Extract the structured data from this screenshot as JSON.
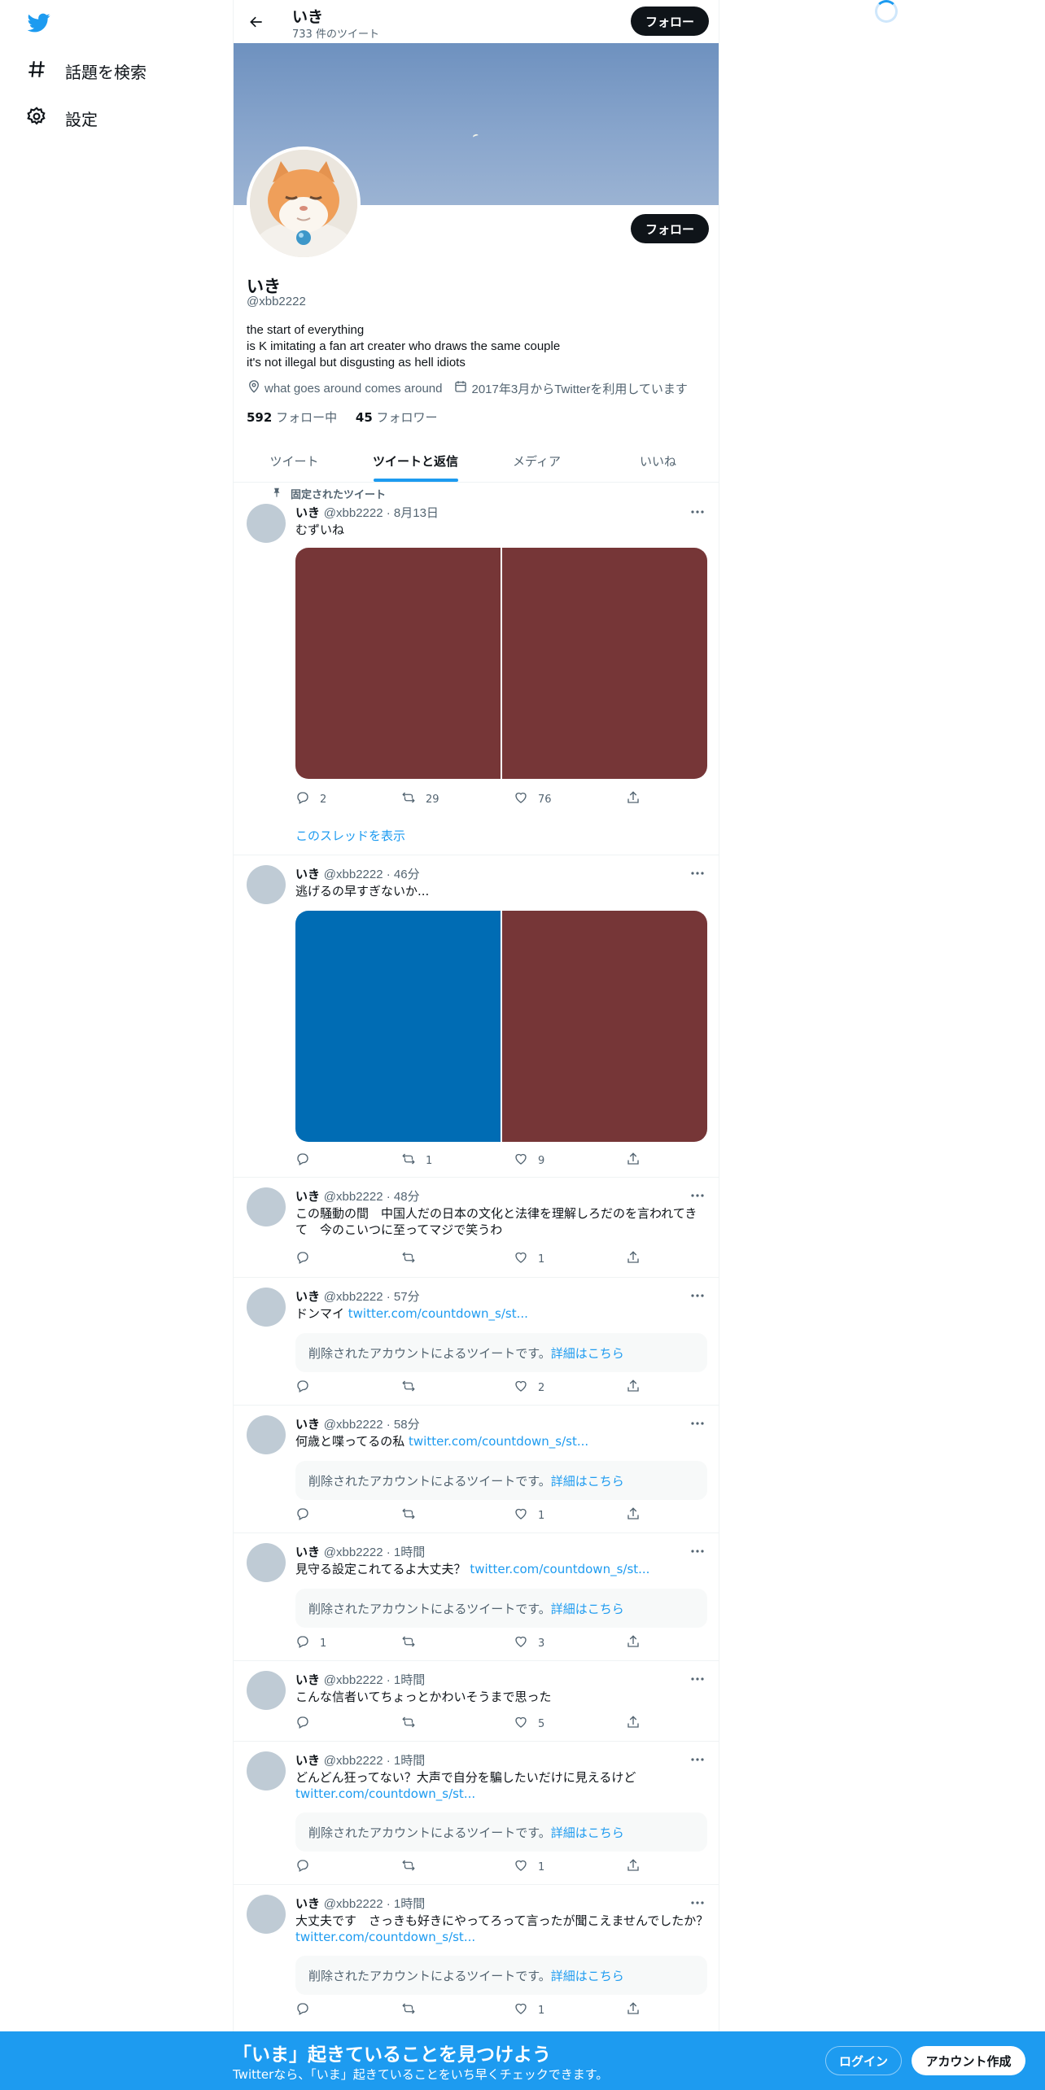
{
  "sidebar": {
    "logo_icon": "twitter-bird-icon",
    "items": [
      {
        "icon": "hashtag-icon",
        "label": "話題を検索"
      },
      {
        "icon": "gear-icon",
        "label": "設定"
      }
    ]
  },
  "header": {
    "name": "いき",
    "tweet_count": "733 件のツイート",
    "follow_label": "フォロー"
  },
  "profile": {
    "name": "いき",
    "handle": "@xbb2222",
    "bio_lines": [
      "the start of everything",
      "is K imitating a fan art creater who draws the same couple",
      "it's not illegal but disgusting as hell idiots"
    ],
    "location": "what goes around comes around",
    "joined": "2017年3月からTwitterを利用しています",
    "following_count": "592",
    "following_label": "フォロー中",
    "followers_count": "45",
    "followers_label": "フォロワー",
    "follow_label": "フォロー"
  },
  "tabs": [
    "ツイート",
    "ツイートと返信",
    "メディア",
    "いいね"
  ],
  "pinned_label": "固定されたツイート",
  "thread_link": "このスレッドを表示",
  "deleted_text": "削除されたアカウントによるツイートです。",
  "deleted_link": "詳細はこちら",
  "tweets": [
    {
      "name": "いき",
      "meta": "@xbb2222 · 8月13日",
      "text": "むずいね",
      "link": "",
      "reply": "2",
      "retweet": "29",
      "like": "76"
    },
    {
      "name": "いき",
      "meta": "@xbb2222 · 46分",
      "text": "逃げるの早すぎないか...",
      "link": "",
      "reply": "",
      "retweet": "1",
      "like": "9"
    },
    {
      "name": "いき",
      "meta": "@xbb2222 · 48分",
      "text": "この騒動の間　中国人だの日本の文化と法律を理解しろだのを言われてきて　今のこいつに至ってマジで笑うわ",
      "link": "",
      "reply": "",
      "retweet": "",
      "like": "1"
    },
    {
      "name": "いき",
      "meta": "@xbb2222 · 57分",
      "text": "ドンマイ ",
      "link": "twitter.com/countdown_s/st...",
      "reply": "",
      "retweet": "",
      "like": "2"
    },
    {
      "name": "いき",
      "meta": "@xbb2222 · 58分",
      "text": "何歳と喋ってるの私 ",
      "link": "twitter.com/countdown_s/st...",
      "reply": "",
      "retweet": "",
      "like": "1"
    },
    {
      "name": "いき",
      "meta": "@xbb2222 · 1時間",
      "text": "見守る設定これてるよ大丈夫？ ",
      "link": "twitter.com/countdown_s/st...",
      "reply": "1",
      "retweet": "",
      "like": "3"
    },
    {
      "name": "いき",
      "meta": "@xbb2222 · 1時間",
      "text": "こんな信者いてちょっとかわいそうまで思った",
      "link": "",
      "reply": "",
      "retweet": "",
      "like": "5"
    },
    {
      "name": "いき",
      "meta": "@xbb2222 · 1時間",
      "text": "どんどん狂ってない？大声で自分を騙したいだけに見えるけど",
      "link": "twitter.com/countdown_s/st...",
      "reply": "",
      "retweet": "",
      "like": "1"
    },
    {
      "name": "いき",
      "meta": "@xbb2222 · 1時間",
      "text": "大丈夫です　さっきも好きにやってろって言ったが聞こえませんでしたか？ ",
      "link": "twitter.com/countdown_s/st...",
      "reply": "",
      "retweet": "",
      "like": "1"
    }
  ],
  "media_colors": {
    "tweet1": [
      "#763637",
      "#763637"
    ],
    "tweet2": [
      "#006cb4",
      "#763637"
    ]
  },
  "bottom_bar": {
    "title": "「いま」起きていることを見つけよう",
    "subtitle": "Twitterなら、「いま」起きていることをいち早くチェックできます。",
    "login": "ログイン",
    "signup": "アカウント作成"
  },
  "colors": {
    "accent": "#1d9bf0",
    "text": "#0f1419",
    "muted": "#536471"
  }
}
